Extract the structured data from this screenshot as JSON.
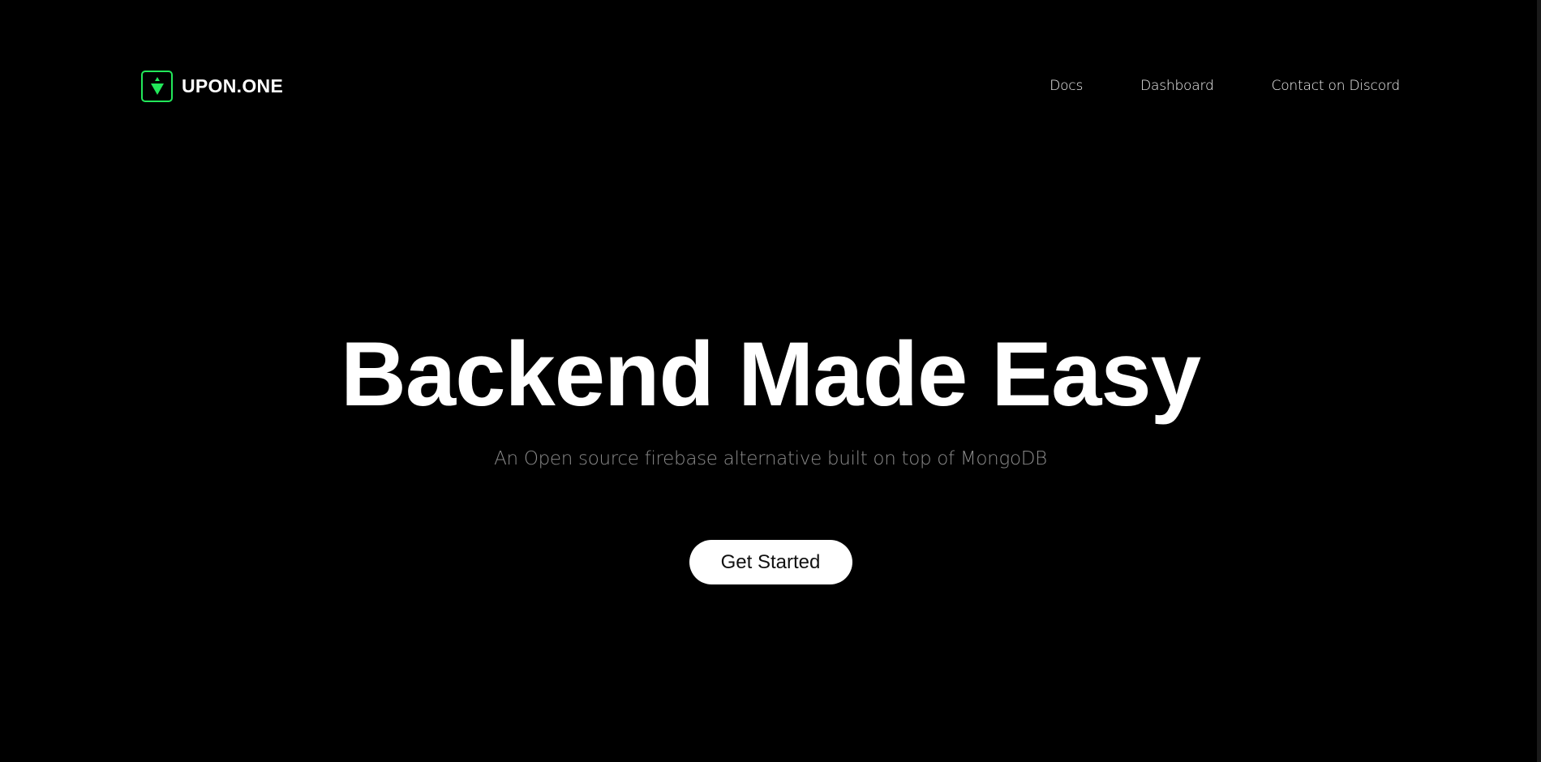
{
  "header": {
    "brand_name": "UPON.ONE",
    "logo_icon": "arrow-down-logo-icon",
    "accent_color": "#22e85a",
    "nav": [
      {
        "label": "Docs"
      },
      {
        "label": "Dashboard"
      },
      {
        "label": "Contact on Discord"
      }
    ]
  },
  "hero": {
    "title": "Backend Made Easy",
    "subtitle": "An Open source firebase alternative built on top of MongoDB",
    "cta_label": "Get Started"
  },
  "colors": {
    "background": "#000000",
    "text": "#ffffff",
    "subtitle": "#8a8a8a",
    "button_bg": "#ffffff",
    "button_text": "#111111"
  }
}
